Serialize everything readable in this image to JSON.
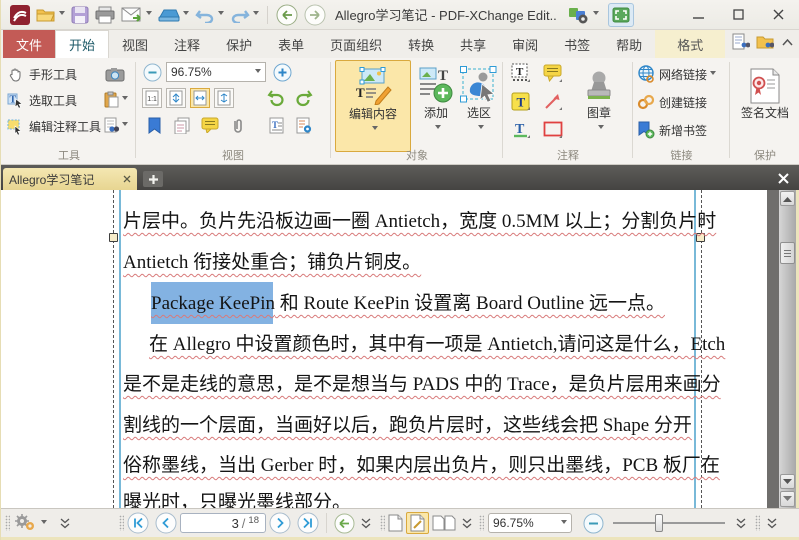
{
  "titlebar": {
    "title": "Allegro学习笔记 - PDF-XChange Edit.."
  },
  "tabs": [
    "文件",
    "开始",
    "视图",
    "注释",
    "保护",
    "表单",
    "页面组织",
    "转换",
    "共享",
    "审阅",
    "书签",
    "帮助",
    "格式"
  ],
  "ribbon": {
    "tools": {
      "label": "工具",
      "hand": "手形工具",
      "select": "选取工具",
      "edit_comment": "编辑注释工具"
    },
    "view": {
      "label": "视图",
      "zoom": "96.75%"
    },
    "object": {
      "label": "对象",
      "edit_content": "编辑内容",
      "add": "添加",
      "select_area": "选区"
    },
    "comment": {
      "label": "注释",
      "stamp": "图章"
    },
    "links": {
      "label": "链接",
      "web_link": "网络链接",
      "create_link": "创建链接",
      "add_bookmark": "新增书签"
    },
    "protect": {
      "label": "保护",
      "sign": "签名文档"
    }
  },
  "doc_tab": {
    "title": "Allegro学习笔记"
  },
  "document": {
    "lines": [
      {
        "text": "片层中。负片先沿板边画一圈 Antietch，宽度 0.5MM 以上；分割负片时"
      },
      {
        "text": "Antietch 衔接处重合；铺负片铜皮。"
      },
      {
        "text_selected": "Package KeePin",
        "text_after": " 和 Route KeePin 设置离 Board Outline 远一点。"
      },
      {
        "text": "在 Allegro 中设置颜色时，其中有一项是 Antietch,请问这是什么，Etch"
      },
      {
        "text": "是不是走线的意思，是不是想当与 PADS 中的 Trace，是负片层用来画分"
      },
      {
        "text": "割线的一个层面，当画好以后，跑负片层时，这些线会把 Shape 分开"
      },
      {
        "text": "俗称墨线，当出 Gerber 时，如果内层出负片，则只出墨线，PCB 板厂在"
      },
      {
        "text": "曝光时，只曝光墨线部分。"
      }
    ]
  },
  "statusbar": {
    "page_current": "3",
    "page_sep": "/",
    "page_total": "18",
    "zoom": "96.75%"
  },
  "colors": {
    "file_tab_red": "#c35b56",
    "active_highlight": "#fbe7a9",
    "text_selection_blue": "#83b2e2"
  }
}
